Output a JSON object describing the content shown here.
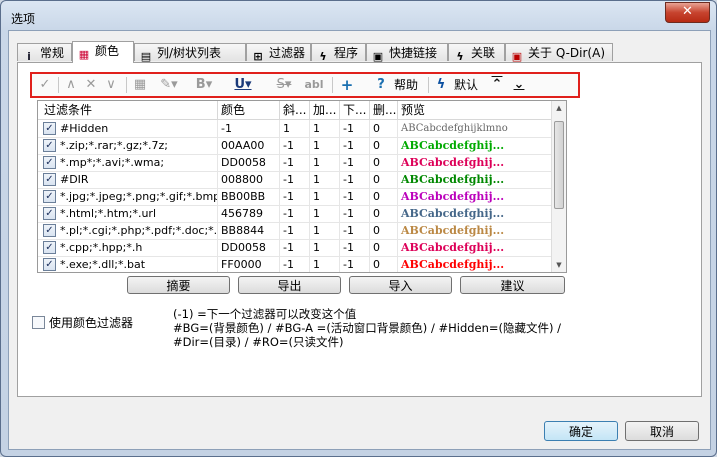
{
  "window": {
    "title": "选项",
    "close_symbol": "✕"
  },
  "tabs": [
    {
      "label": "常规",
      "icon": "info-icon",
      "glyph": "i"
    },
    {
      "label": "颜色",
      "icon": "color-grid-icon",
      "glyph": "▦"
    },
    {
      "label": "列/树状列表",
      "icon": "table-icon",
      "glyph": "▤"
    },
    {
      "label": "过滤器",
      "icon": "filter-icon",
      "glyph": "⊞"
    },
    {
      "label": "程序",
      "icon": "lightning-icon",
      "glyph": "ϟ"
    },
    {
      "label": "快捷链接",
      "icon": "link-icon",
      "glyph": "▣"
    },
    {
      "label": "关联",
      "icon": "association-icon",
      "glyph": "ϟ"
    },
    {
      "label": "关于 Q-Dir(A)",
      "icon": "about-icon",
      "glyph": "▣"
    }
  ],
  "toolbar": {
    "help_label": "帮助",
    "default_label": "默认",
    "help_glyph": "?",
    "plus_glyph": "+",
    "check_glyph": "✓",
    "up_glyph": "∧",
    "x_glyph": "✕",
    "down_glyph": "∨",
    "bold_glyph": "B",
    "underline_glyph": "U",
    "strike_glyph": "S",
    "abl_glyph": "abl",
    "move_top_glyph": "⌃",
    "move_bottom_glyph": "⌄",
    "default_glyph": "ϟ"
  },
  "grid": {
    "columns": [
      "过滤条件",
      "颜色",
      "斜...",
      "加...",
      "下...",
      "删...",
      "预览"
    ],
    "rows": [
      {
        "checked": "✓",
        "filter": "#Hidden",
        "color": "-1",
        "italic": "1",
        "bold": "1",
        "underline": "-1",
        "strike": "0",
        "preview": "ABCabcdefghijklmno",
        "preview_color": "#666666"
      },
      {
        "checked": "✓",
        "filter": "*.zip;*.rar;*.gz;*.7z;",
        "color": "00AA00",
        "italic": "-1",
        "bold": "1",
        "underline": "-1",
        "strike": "0",
        "preview": "ABCabcdefghij...",
        "preview_color": "#00AA00"
      },
      {
        "checked": "✓",
        "filter": "*.mp*;*.avi;*.wma;",
        "color": "DD0058",
        "italic": "-1",
        "bold": "1",
        "underline": "-1",
        "strike": "0",
        "preview": "ABCabcdefghij...",
        "preview_color": "#DD0058"
      },
      {
        "checked": "✓",
        "filter": "#DIR",
        "color": "008800",
        "italic": "-1",
        "bold": "1",
        "underline": "-1",
        "strike": "0",
        "preview": "ABCabcdefghij...",
        "preview_color": "#008800"
      },
      {
        "checked": "✓",
        "filter": "*.jpg;*.jpeg;*.png;*.gif;*.bmp;*.ico",
        "color": "BB00BB",
        "italic": "-1",
        "bold": "1",
        "underline": "-1",
        "strike": "0",
        "preview": "ABCabcdefghij...",
        "preview_color": "#BB00BB"
      },
      {
        "checked": "✓",
        "filter": "*.html;*.htm;*.url",
        "color": "456789",
        "italic": "-1",
        "bold": "1",
        "underline": "-1",
        "strike": "0",
        "preview": "ABCabcdefghij...",
        "preview_color": "#456789"
      },
      {
        "checked": "✓",
        "filter": "*.pl;*.cgi;*.php;*.pdf;*.doc;*.rtf;*...",
        "color": "BB8844",
        "italic": "-1",
        "bold": "1",
        "underline": "-1",
        "strike": "0",
        "preview": "ABCabcdefghij...",
        "preview_color": "#BB8844"
      },
      {
        "checked": "✓",
        "filter": "*.cpp;*.hpp;*.h",
        "color": "DD0058",
        "italic": "-1",
        "bold": "1",
        "underline": "-1",
        "strike": "0",
        "preview": "ABCabcdefghij...",
        "preview_color": "#DD0058"
      },
      {
        "checked": "✓",
        "filter": "*.exe;*.dll;*.bat",
        "color": "FF0000",
        "italic": "-1",
        "bold": "1",
        "underline": "-1",
        "strike": "0",
        "preview": "ABCabcdefghij...",
        "preview_color": "#FF0000"
      }
    ]
  },
  "actions": {
    "summary": "摘要",
    "export": "导出",
    "import": "导入",
    "suggest": "建议"
  },
  "use_color_filter": {
    "label": "使用颜色过滤器",
    "checked": false
  },
  "notes": {
    "line1": "(-1) =下一个过滤器可以改变这个值",
    "line2": "#BG=(背景颜色) / #BG-A =(活动窗口背景颜色) / #Hidden=(隐藏文件) / #Dir=(目录) / #RO=(只读文件)"
  },
  "footer": {
    "ok": "确定",
    "cancel": "取消"
  },
  "colors": {
    "highlight_border": "#e0201c",
    "default_button": "#3c7fb1"
  }
}
